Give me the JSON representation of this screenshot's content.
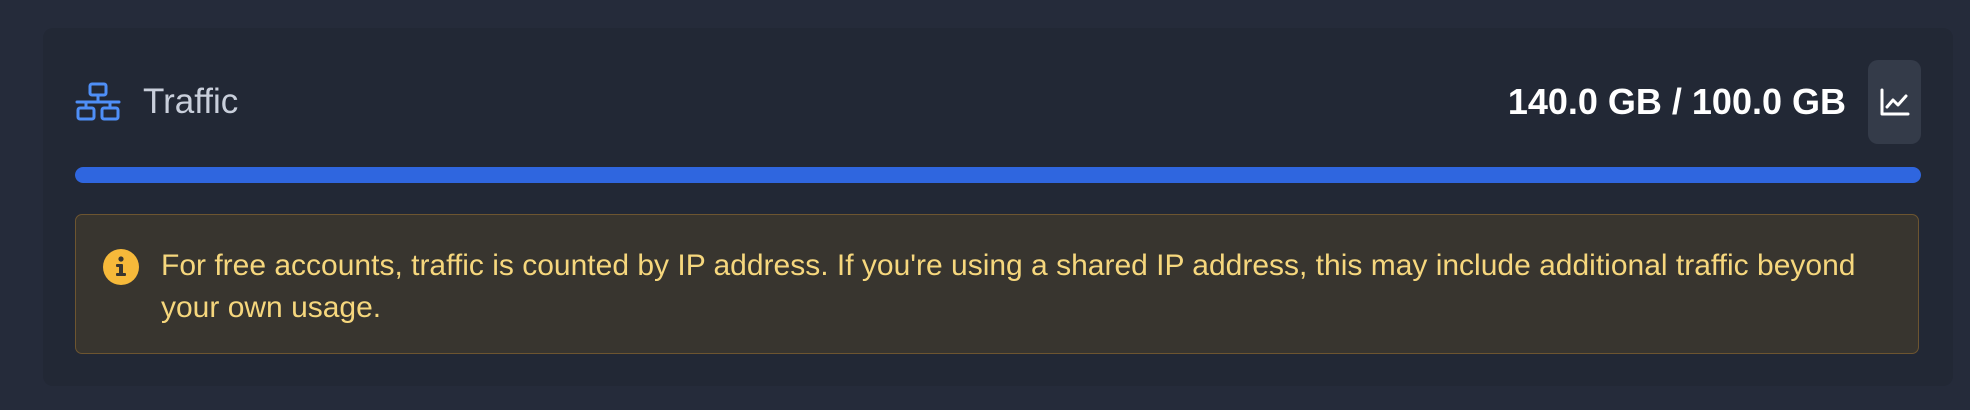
{
  "card": {
    "title": "Traffic",
    "title_icon": "network-icon",
    "usage_text": "140.0 GB / 100.0 GB",
    "chart_button_icon": "line-chart-icon",
    "progress_percent": 100
  },
  "notice": {
    "icon": "info-icon",
    "text": "For free accounts, traffic is counted by IP address. If you're using a shared IP address, this may include additional traffic beyond your own usage."
  },
  "colors": {
    "accent": "#2f66df",
    "icon_blue": "#4f8ff7",
    "warning_icon": "#f6b93a",
    "warning_text": "#f6d77d"
  }
}
